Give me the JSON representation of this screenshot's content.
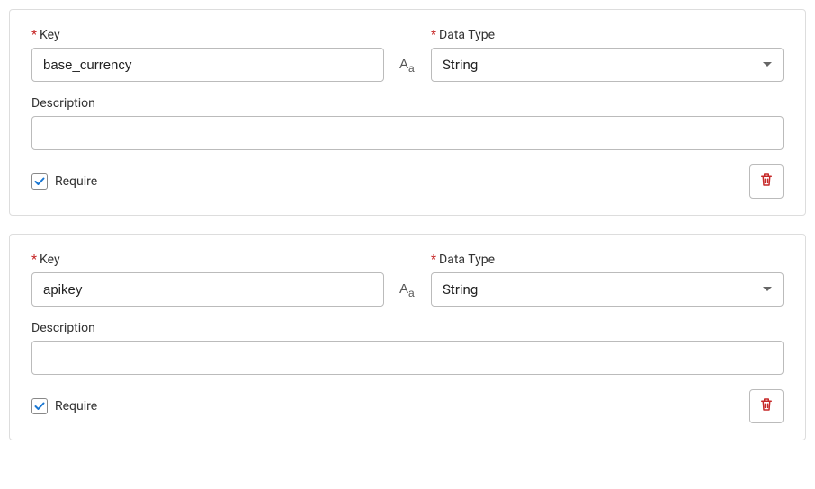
{
  "labels": {
    "key": "Key",
    "dataType": "Data Type",
    "description": "Description",
    "require": "Require"
  },
  "params": [
    {
      "key": "base_currency",
      "dataType": "String",
      "description": "",
      "required": true
    },
    {
      "key": "apikey",
      "dataType": "String",
      "description": "",
      "required": true
    }
  ]
}
